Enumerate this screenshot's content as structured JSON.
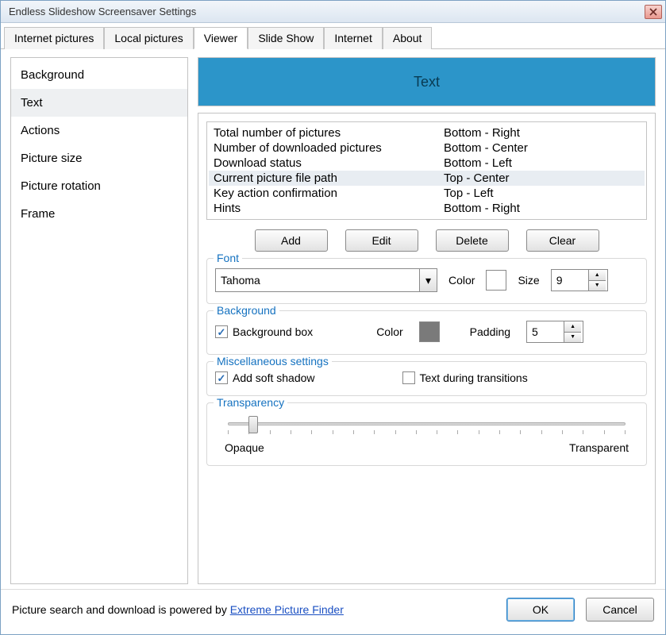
{
  "window_title": "Endless Slideshow Screensaver Settings",
  "tabs": [
    "Internet pictures",
    "Local pictures",
    "Viewer",
    "Slide Show",
    "Internet",
    "About"
  ],
  "active_tab": 2,
  "sidebar": {
    "items": [
      "Background",
      "Text",
      "Actions",
      "Picture size",
      "Picture rotation",
      "Frame"
    ],
    "selected": 1
  },
  "panel_title": "Text",
  "grid": {
    "selected": 3,
    "rows": [
      {
        "name": "Total number of pictures",
        "pos": "Bottom - Right"
      },
      {
        "name": "Number of downloaded pictures",
        "pos": "Bottom - Center"
      },
      {
        "name": "Download status",
        "pos": "Bottom - Left"
      },
      {
        "name": "Current picture file path",
        "pos": "Top - Center"
      },
      {
        "name": "Key action confirmation",
        "pos": "Top - Left"
      },
      {
        "name": "Hints",
        "pos": "Bottom - Right"
      }
    ]
  },
  "grid_buttons": {
    "add": "Add",
    "edit": "Edit",
    "delete": "Delete",
    "clear": "Clear"
  },
  "font": {
    "legend": "Font",
    "family": "Tahoma",
    "color_label": "Color",
    "size_label": "Size",
    "size": "9"
  },
  "background": {
    "legend": "Background",
    "box_label": "Background box",
    "box_checked": true,
    "color_label": "Color",
    "padding_label": "Padding",
    "padding": "5"
  },
  "misc": {
    "legend": "Miscellaneous settings",
    "shadow_label": "Add soft shadow",
    "shadow_checked": true,
    "trans_label": "Text during transitions",
    "trans_checked": false
  },
  "transparency": {
    "legend": "Transparency",
    "left": "Opaque",
    "right": "Transparent"
  },
  "footer": {
    "text": "Picture search and download is powered by ",
    "link": "Extreme Picture Finder",
    "ok": "OK",
    "cancel": "Cancel"
  }
}
